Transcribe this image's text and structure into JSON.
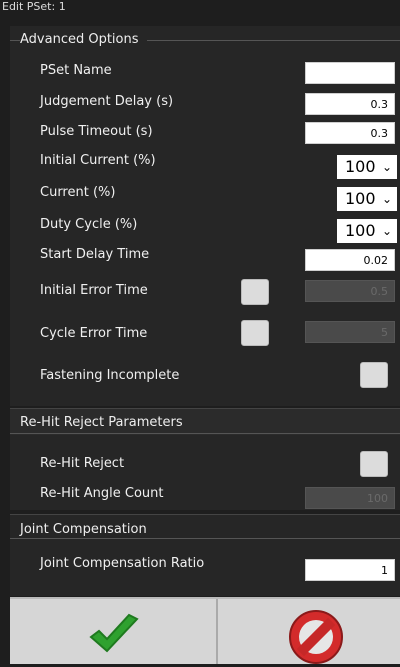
{
  "title": "Edit PSet: 1",
  "sections": {
    "advanced": "Advanced Options",
    "rehit": "Re-Hit Reject Parameters",
    "joint": "Joint Compensation"
  },
  "fields": {
    "pset_name": {
      "label": "PSet Name",
      "value": ""
    },
    "judgement_delay": {
      "label": "Judgement Delay (s)",
      "value": "0.3"
    },
    "pulse_timeout": {
      "label": "Pulse Timeout (s)",
      "value": "0.3"
    },
    "initial_current": {
      "label": "Initial Current (%)",
      "value": "100"
    },
    "current": {
      "label": "Current (%)",
      "value": "100"
    },
    "duty_cycle": {
      "label": "Duty Cycle (%)",
      "value": "100"
    },
    "start_delay": {
      "label": "Start Delay Time",
      "value": "0.02"
    },
    "initial_error": {
      "label": "Initial Error Time",
      "value": "0.5"
    },
    "cycle_error": {
      "label": "Cycle Error Time",
      "value": "5"
    },
    "fastening_incomplete": {
      "label": "Fastening Incomplete"
    },
    "rehit_reject": {
      "label": "Re-Hit Reject"
    },
    "rehit_angle": {
      "label": "Re-Hit Angle Count",
      "value": "100"
    },
    "joint_ratio": {
      "label": "Joint Compensation Ratio",
      "value": "1"
    }
  },
  "icons": {
    "confirm": "check-icon",
    "cancel": "no-entry-icon"
  },
  "colors": {
    "confirm": "#2fa12f",
    "cancel": "#d32b2b"
  }
}
